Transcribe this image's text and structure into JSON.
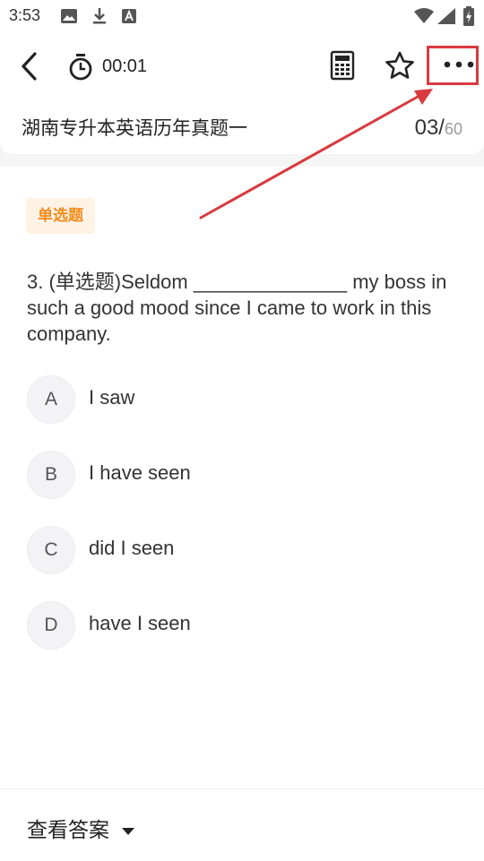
{
  "status_bar": {
    "time": "3:53",
    "icons": [
      "image-icon",
      "download-icon",
      "a-letter-icon",
      "wifi-icon",
      "signal-icon",
      "battery-icon"
    ]
  },
  "toolbar": {
    "back_icon": "chevron-left-icon",
    "timer_icon": "stopwatch-icon",
    "timer_value": "00:01",
    "calculator_icon": "calculator-icon",
    "favorite_icon": "star-icon",
    "more_icon": "more-dots-icon"
  },
  "paper": {
    "title": "湖南专升本英语历年真题一",
    "current": "03",
    "slash": "/",
    "total": "60"
  },
  "question": {
    "type_badge": "单选题",
    "text": "3. (单选题)Seldom ______________ my boss in such a good mood since I came to work in this company.",
    "options": [
      {
        "letter": "A",
        "text": "I saw"
      },
      {
        "letter": "B",
        "text": "I have seen"
      },
      {
        "letter": "C",
        "text": "did I seen"
      },
      {
        "letter": "D",
        "text": "have I seen"
      }
    ]
  },
  "footer": {
    "view_answer": "查看答案",
    "dropdown_icon": "caret-down-icon"
  },
  "colors": {
    "badge_text": "#f28b1c",
    "badge_bg": "#fff3e6",
    "annotation_red": "#d83a3f",
    "option_circle_bg": "#f3f3f5"
  }
}
